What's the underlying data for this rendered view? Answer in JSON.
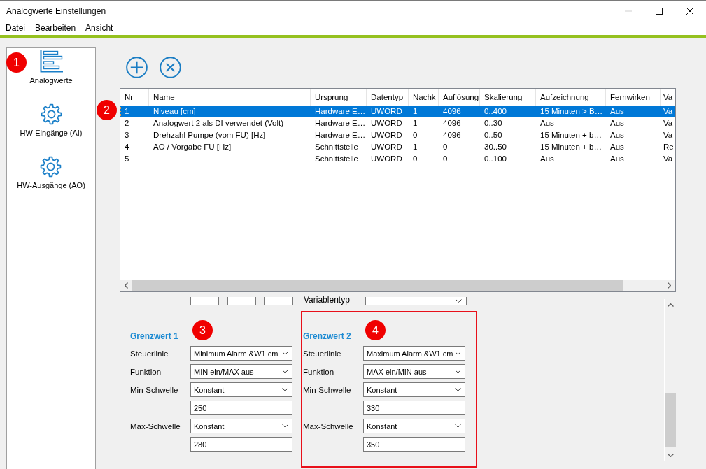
{
  "window": {
    "title": "Analogwerte Einstellungen",
    "controls": [
      {
        "kind": "minimize",
        "disabled": true
      },
      {
        "kind": "maximize",
        "disabled": false
      },
      {
        "kind": "close",
        "disabled": false
      }
    ]
  },
  "menu": [
    "Datei",
    "Bearbeiten",
    "Ansicht"
  ],
  "sidebar": {
    "marker": "1",
    "items": [
      {
        "kind": "chart",
        "label": "Analogwerte"
      },
      {
        "kind": "gear",
        "label": "HW-Eingänge (AI)"
      },
      {
        "kind": "gear",
        "label": "HW-Ausgänge (AO)"
      }
    ]
  },
  "table": {
    "marker": "2",
    "columns": [
      "Nr",
      "Name",
      "Ursprung",
      "Datentyp",
      "Nachk",
      "Auflösung",
      "Skalierung",
      "Aufzeichnung",
      "Fernwirken",
      "Va"
    ],
    "rows": [
      {
        "selected": true,
        "cells": [
          "1",
          "Niveau [cm]",
          "Hardware E…",
          "UWORD",
          "1",
          "4096",
          "0..400",
          "15 Minuten > B…",
          "Aus",
          "Va"
        ]
      },
      {
        "selected": false,
        "cells": [
          "2",
          "Analogwert 2 als DI verwendet (Volt)",
          "Hardware E…",
          "UWORD",
          "1",
          "4096",
          "0..30",
          "Aus",
          "Aus",
          "Va"
        ]
      },
      {
        "selected": false,
        "cells": [
          "3",
          "Drehzahl Pumpe (vom FU) [Hz]",
          "Hardware E…",
          "UWORD",
          "0",
          "4096",
          "0..50",
          "15 Minuten + b…",
          "Aus",
          "Va"
        ]
      },
      {
        "selected": false,
        "cells": [
          "4",
          "AO / Vorgabe FU [Hz]",
          "Schnittstelle",
          "UWORD",
          "1",
          "0",
          "30..50",
          "15 Minuten + b…",
          "Aus",
          "Re"
        ]
      },
      {
        "selected": false,
        "cells": [
          "5",
          null,
          "Schnittstelle",
          "UWORD",
          "0",
          "0",
          "0..100",
          "Aus",
          "Aus",
          "Va"
        ]
      }
    ]
  },
  "form": {
    "clipped_row": {
      "label": "Variablentyp"
    },
    "limits": [
      {
        "title": "Grenzwert 1",
        "marker": "3",
        "highlighted": false,
        "fields": [
          {
            "kind": "dropdown",
            "label": "Steuerlinie",
            "value": "Minimum Alarm &W1 cm"
          },
          {
            "kind": "dropdown",
            "label": "Funktion",
            "value": "MIN ein/MAX aus"
          },
          {
            "kind": "dropdown",
            "label": "Min-Schwelle",
            "value": "Konstant"
          },
          {
            "kind": "input",
            "value": "250"
          },
          {
            "kind": "dropdown",
            "label": "Max-Schwelle",
            "value": "Konstant"
          },
          {
            "kind": "input",
            "value": "280"
          }
        ]
      },
      {
        "title": "Grenzwert 2",
        "marker": "4",
        "highlighted": true,
        "fields": [
          {
            "kind": "dropdown",
            "label": "Steuerlinie",
            "value": "Maximum Alarm &W1 cm"
          },
          {
            "kind": "dropdown",
            "label": "Funktion",
            "value": "MAX ein/MIN aus"
          },
          {
            "kind": "dropdown",
            "label": "Min-Schwelle",
            "value": "Konstant"
          },
          {
            "kind": "input",
            "value": "330"
          },
          {
            "kind": "dropdown",
            "label": "Max-Schwelle",
            "value": "Konstant"
          },
          {
            "kind": "input",
            "value": "350"
          }
        ]
      }
    ]
  }
}
